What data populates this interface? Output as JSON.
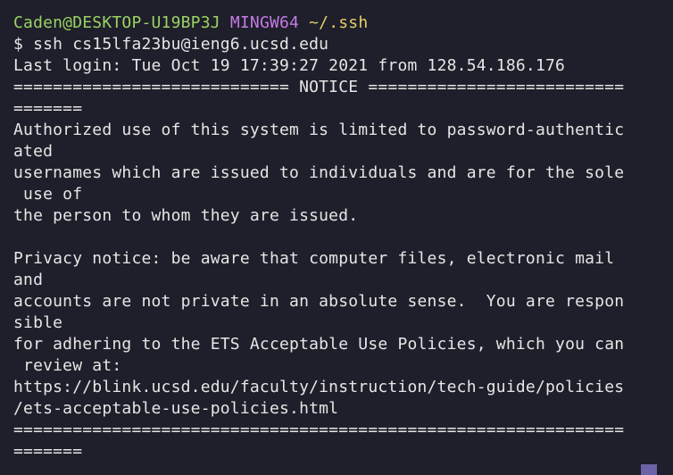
{
  "prompt": {
    "user_host": "Caden@DESKTOP-U19BP3J",
    "system": "MINGW64",
    "path": "~/.ssh"
  },
  "command_line": "$ ssh cs15lfa23bu@ieng6.ucsd.edu",
  "output_lines": [
    "Last login: Tue Oct 19 17:39:27 2021 from 128.54.186.176",
    "============================ NOTICE ==========================",
    "=======",
    "Authorized use of this system is limited to password-authentic",
    "ated",
    "usernames which are issued to individuals and are for the sole",
    " use of",
    "the person to whom they are issued.",
    "",
    "Privacy notice: be aware that computer files, electronic mail",
    "and",
    "accounts are not private in an absolute sense.  You are respon",
    "sible",
    "for adhering to the ETS Acceptable Use Policies, which you can",
    " review at:",
    "https://blink.ucsd.edu/faculty/instruction/tech-guide/policies",
    "/ets-acceptable-use-policies.html",
    "==============================================================",
    "======="
  ],
  "colors": {
    "background": "#1e1f2a",
    "text": "#e6e6e6",
    "prompt_user": "#9bd264",
    "prompt_system": "#c57ae6",
    "prompt_path": "#e4cf6a",
    "scroll_thumb": "#6a63a8"
  }
}
